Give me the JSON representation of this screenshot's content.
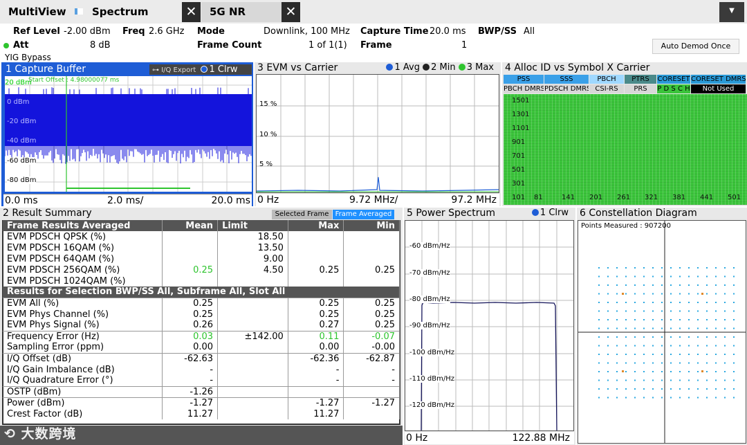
{
  "tabs": {
    "multiview": "MultiView",
    "spectrum": "Spectrum",
    "nr": "5G NR",
    "close": "✕"
  },
  "menu": "▼",
  "settings": {
    "ref_level_label": "Ref Level",
    "ref_level": "-2.00 dBm",
    "freq_label": "Freq",
    "freq": "2.6 GHz",
    "mode_label": "Mode",
    "mode": "Downlink, 100 MHz",
    "capture_time_label": "Capture Time",
    "capture_time": "20.0 ms",
    "bwp_label": "BWP/SS",
    "bwp": "All",
    "att_label": "Att",
    "att": "8 dB",
    "frame_count_label": "Frame Count",
    "frame_count": "1 of 1(1)",
    "frame_label": "Frame",
    "frame": "1",
    "yig": "YIG Bypass",
    "auto_demod": "Auto Demod Once"
  },
  "capture": {
    "title": "1 Capture Buffer",
    "iq_export": "I/Q Export",
    "trace": "1 Clrw",
    "y_labels": [
      "20 dBm",
      "0 dBm",
      "-20 dBm",
      "-40 dBm",
      "-60 dBm",
      "-80 dBm"
    ],
    "marker": "Start Offset : 4.98000077 ms",
    "x_start": "0.0 ms",
    "x_div": "2.0 ms/",
    "x_end": "20.0 ms"
  },
  "evm": {
    "title": "3 EVM vs Carrier",
    "legend": [
      "1 Avg",
      "2 Min",
      "3 Max"
    ],
    "y_labels": [
      "15 %",
      "10 %",
      "5 %"
    ],
    "x_start": "0 Hz",
    "x_div": "9.72 MHz/",
    "x_end": "97.2 MHz"
  },
  "alloc": {
    "title": "4 Alloc ID vs Symbol X Carrier",
    "row1": [
      "PSS",
      "SSS",
      "PBCH",
      "PTRS",
      "CORESET",
      "CORESET DMRS"
    ],
    "row2": [
      "PBCH DMRS",
      "PDSCH DMRS",
      "CSI-RS",
      "PRS",
      "P D S C H",
      "Not Used"
    ],
    "y_labels": [
      "1501",
      "1301",
      "1101",
      "901",
      "701",
      "501",
      "301",
      "101"
    ],
    "x_labels": [
      "81",
      "141",
      "201",
      "261",
      "321",
      "381",
      "441",
      "501"
    ]
  },
  "summary": {
    "title": "2 Result Summary",
    "btn_selected": "Selected Frame",
    "btn_averaged": "Frame Averaged",
    "header": [
      "Frame Results Averaged",
      "Mean",
      "Limit",
      "Max",
      "Min"
    ],
    "rows1": [
      [
        "EVM PDSCH QPSK (%)",
        "",
        "18.50",
        "",
        ""
      ],
      [
        "EVM PDSCH 16QAM (%)",
        "",
        "13.50",
        "",
        ""
      ],
      [
        "EVM PDSCH 64QAM (%)",
        "",
        "9.00",
        "",
        ""
      ],
      [
        "EVM PDSCH 256QAM (%)",
        "0.25",
        "4.50",
        "0.25",
        "0.25"
      ],
      [
        "EVM PDSCH 1024QAM (%)",
        "",
        "",
        "",
        ""
      ]
    ],
    "section2": "Results for Selection  BWP/SS All,  Subframe All,  Slot All",
    "rows2": [
      [
        "EVM All (%)",
        "0.25",
        "",
        "0.25",
        "0.25"
      ],
      [
        "EVM Phys Channel (%)",
        "0.25",
        "",
        "0.25",
        "0.25"
      ],
      [
        "EVM Phys Signal (%)",
        "0.26",
        "",
        "0.27",
        "0.25"
      ],
      [
        "Frequency Error (Hz)",
        "0.03",
        "±142.00",
        "0.11",
        "-0.07"
      ],
      [
        "Sampling Error (ppm)",
        "0.00",
        "",
        "0.00",
        "-0.00"
      ],
      [
        "I/Q Offset (dB)",
        "-62.63",
        "",
        "-62.36",
        "-62.87"
      ],
      [
        "I/Q Gain Imbalance (dB)",
        "-",
        "",
        "-",
        "-"
      ],
      [
        "I/Q Quadrature Error (°)",
        "-",
        "",
        "-",
        "-"
      ],
      [
        "OSTP (dBm)",
        "-1.26",
        "",
        "",
        ""
      ],
      [
        "Power (dBm)",
        "-1.27",
        "",
        "-1.27",
        "-1.27"
      ],
      [
        "Crest Factor (dB)",
        "11.27",
        "",
        "11.27",
        ""
      ]
    ]
  },
  "power": {
    "title": "5 Power Spectrum",
    "trace": "1 Clrw",
    "y_labels": [
      "-60 dBm/Hz",
      "-70 dBm/Hz",
      "-80 dBm/Hz",
      "-90 dBm/Hz",
      "-100 dBm/Hz",
      "-110 dBm/Hz",
      "-120 dBm/Hz"
    ],
    "x_start": "0 Hz",
    "x_end": "122.88 MHz"
  },
  "constellation": {
    "title": "6 Constellation Diagram",
    "points": "Points Measured : 907200"
  },
  "watermark": "大数跨境",
  "colors": {
    "accent": "#1e5dd6",
    "green": "#2ec42e",
    "capture_blue": "#1414dc",
    "alloc_green": "#3bc43b"
  }
}
